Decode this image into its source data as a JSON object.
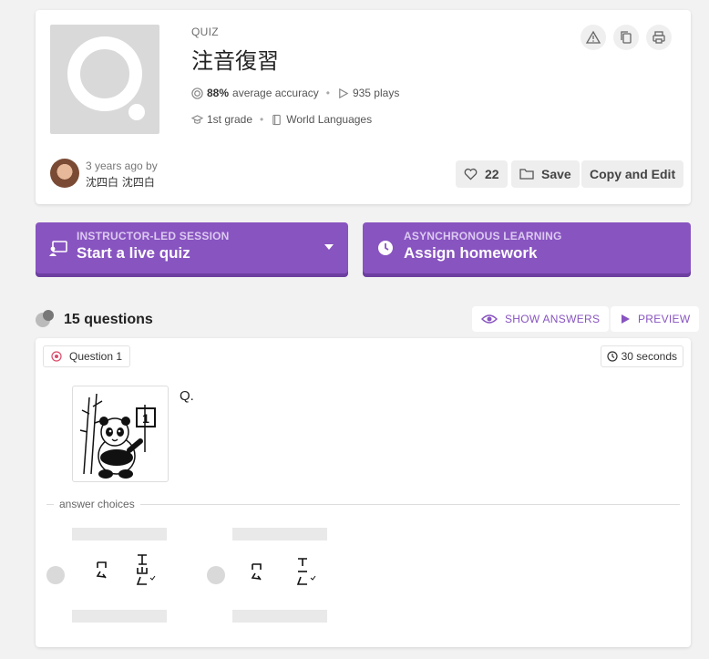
{
  "quiz": {
    "type_label": "QUIZ",
    "title": "注音復習",
    "accuracy": "88%",
    "accuracy_suffix": "average accuracy",
    "plays": "935 plays",
    "grade": "1st grade",
    "subject": "World Languages",
    "author_time": "3 years ago by",
    "author_name": "沈四白 沈四白",
    "likes": "22",
    "save_label": "Save",
    "copy_edit_label": "Copy and Edit"
  },
  "actions": {
    "live": {
      "sub": "INSTRUCTOR-LED SESSION",
      "main": "Start a live quiz"
    },
    "homework": {
      "sub": "ASYNCHRONOUS LEARNING",
      "main": "Assign homework"
    }
  },
  "questions_header": {
    "count_label": "15 questions",
    "show_answers": "SHOW ANSWERS",
    "preview": "PREVIEW"
  },
  "question": {
    "label": "Question 1",
    "time": "30 seconds",
    "text": "Q.",
    "answer_choices_label": "answer choices"
  },
  "colors": {
    "accent": "#8854c0",
    "accent_shadow": "#6c3fa0",
    "background": "#f2f2f2"
  }
}
